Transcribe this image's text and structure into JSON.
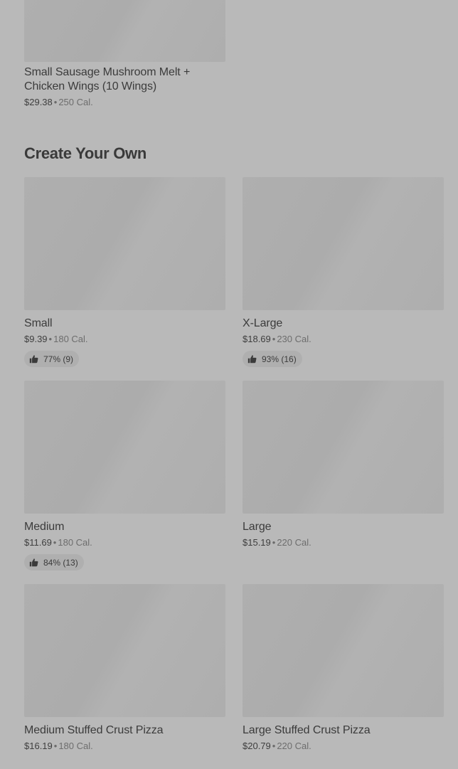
{
  "top_item": {
    "title": "Small Sausage Mushroom Melt + Chicken Wings (10 Wings)",
    "price": "$29.38",
    "calories": "250 Cal."
  },
  "section": {
    "title": "Create Your Own"
  },
  "items": [
    {
      "title": "Small",
      "price": "$9.39",
      "calories": "180 Cal.",
      "rating": "77% (9)"
    },
    {
      "title": "X-Large",
      "price": "$18.69",
      "calories": "230 Cal.",
      "rating": "93% (16)"
    },
    {
      "title": "Medium",
      "price": "$11.69",
      "calories": "180 Cal.",
      "rating": "84% (13)"
    },
    {
      "title": "Large",
      "price": "$15.19",
      "calories": "220 Cal."
    },
    {
      "title": "Medium Stuffed Crust Pizza",
      "price": "$16.19",
      "calories": "180 Cal."
    },
    {
      "title": "Large Stuffed Crust Pizza",
      "price": "$20.79",
      "calories": "220 Cal."
    }
  ],
  "separator": "•",
  "icons": {
    "rating": "thumbs-up-icon"
  }
}
